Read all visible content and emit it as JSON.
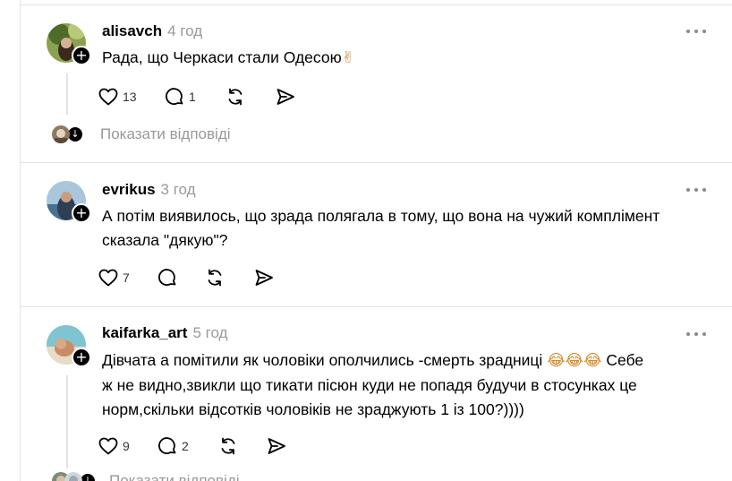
{
  "posts": [
    {
      "username": "alisavch",
      "time": "4 год",
      "text": "Рада, що Черкаси стали Одесою",
      "emoji": "✌",
      "likes": "13",
      "replies": "1",
      "reply_link": "Показати відповіді"
    },
    {
      "username": "evrikus",
      "time": "3 год",
      "text_line1": "А потім виявилось, що зрада полягала в тому, що вона на чужий комплімент",
      "text_line2": "сказала \"дякую\"?",
      "likes": "7",
      "replies": ""
    },
    {
      "username": "kaifarka_art",
      "time": "5 год",
      "text_line1": "Дівчата а помітили як чоловіки ополчились -смерть зрадниці",
      "emojis": "😂😂😂",
      "text_line1_end": "Себе",
      "text_line2": "ж не видно,звикли що тикати пісюн куди не попадя будучи в стосунках це",
      "text_line3": "норм,скільки відсотків чоловіків не зраджують 1 із 100?))))",
      "likes": "9",
      "replies": "2",
      "reply_link": "Показати відповіді"
    }
  ],
  "icons": {
    "like": "heart-icon",
    "comment": "comment-icon",
    "repost": "repost-icon",
    "share": "share-icon",
    "more": "more-icon",
    "follow": "plus-icon"
  },
  "colors": {
    "secondary_text": "#999999",
    "divider": "#e3e3e3",
    "icon": "#000000"
  }
}
